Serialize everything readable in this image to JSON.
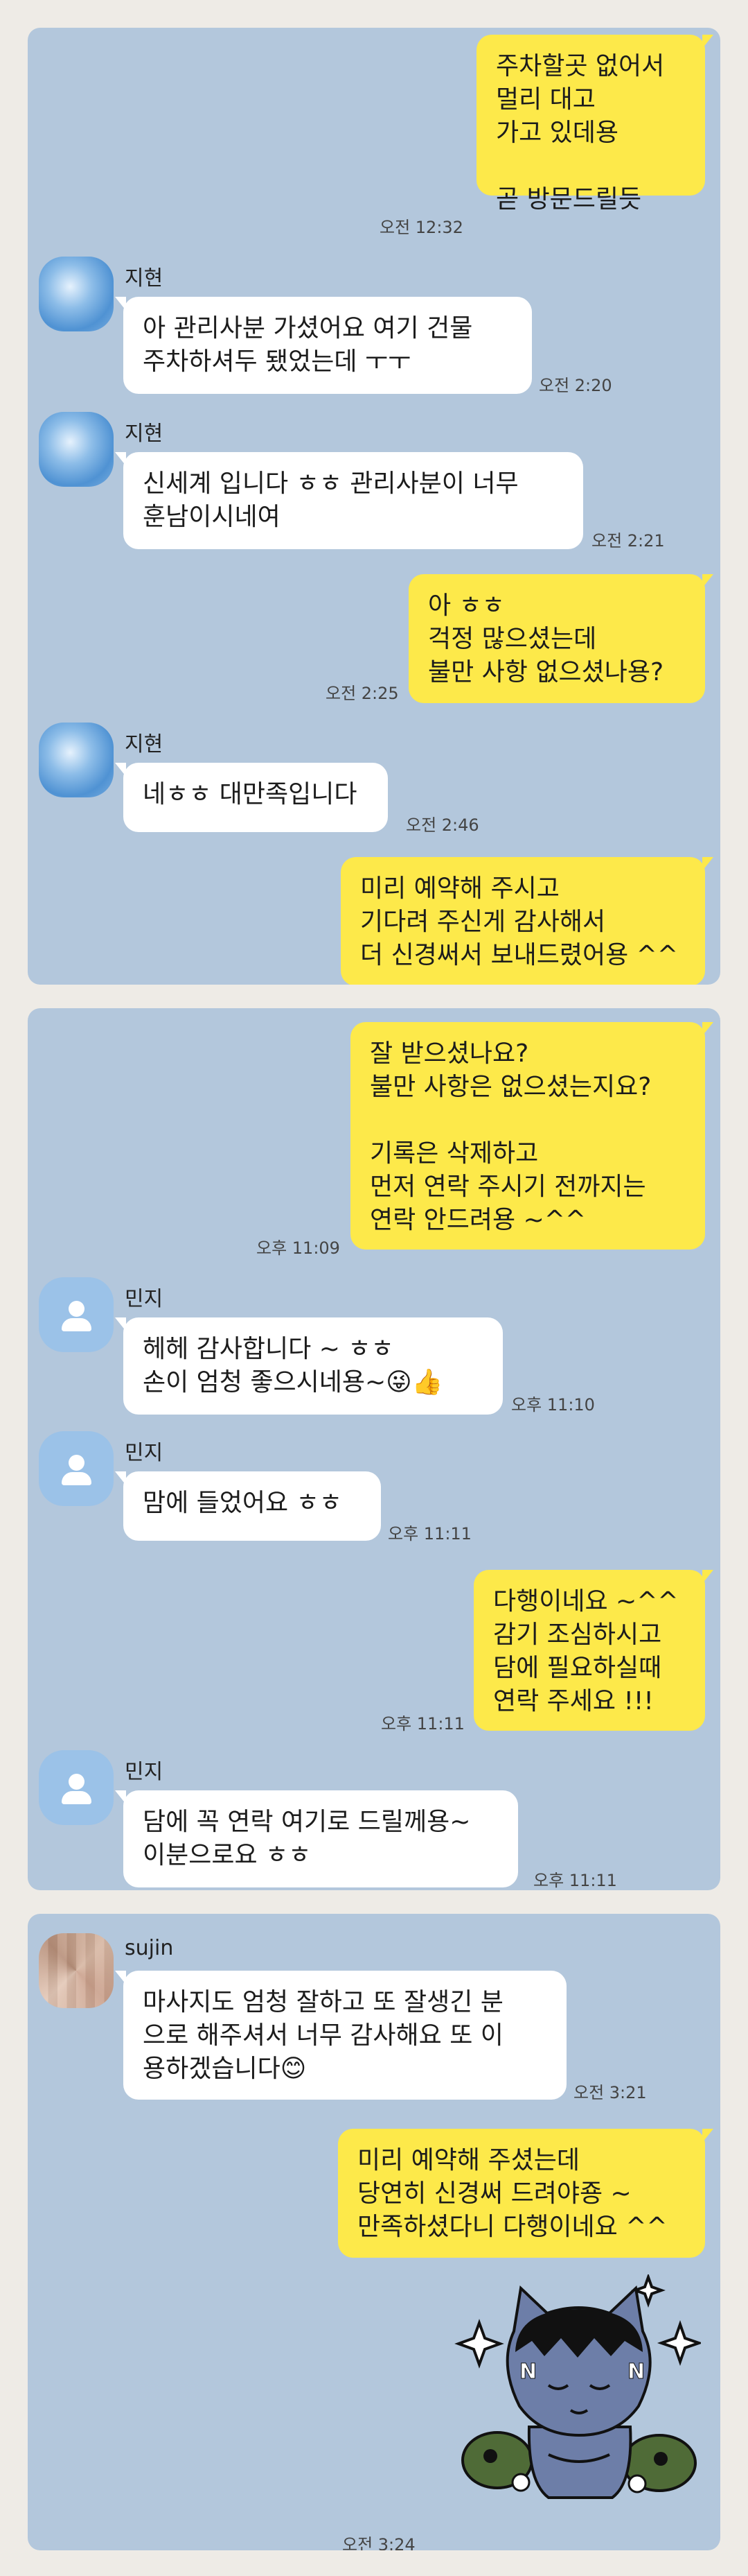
{
  "panel1": {
    "m1": {
      "text": "주차할곳 없어서\n멀리 대고\n가고 있데용\n\n곧 방문드릴듯",
      "time": "오전 12:32"
    },
    "m2": {
      "sender": "지현",
      "text": "아 관리사분 가셨어요 여기 건물\n주차하셔두 됐었는데 ㅜㅜ",
      "time": "오전 2:20"
    },
    "m3": {
      "sender": "지현",
      "text": "신세계 입니다 ㅎㅎ 관리사분이 너무\n훈남이시네여",
      "time": "오전 2:21"
    },
    "m4": {
      "text": "아 ㅎㅎ\n걱정 많으셨는데\n불만 사항 없으셨나용?",
      "time": "오전 2:25"
    },
    "m5": {
      "sender": "지현",
      "text": "네ㅎㅎ 대만족입니다",
      "time": "오전 2:46"
    },
    "m6": {
      "text": "미리 예약해 주시고\n기다려 주신게 감사해서\n더 신경써서 보내드렸어용 ^^"
    }
  },
  "panel2": {
    "m1": {
      "text": "잘 받으셨나요?\n불만 사항은 없으셨는지요?\n\n기록은 삭제하고\n먼저 연락 주시기 전까지는\n연락 안드려용 ~^^",
      "time": "오후 11:09"
    },
    "m2": {
      "sender": "민지",
      "text": "헤헤 감사합니다 ~ ㅎㅎ\n손이 엄청 좋으시네용~",
      "emoji": "😜👍",
      "time": "오후 11:10"
    },
    "m3": {
      "sender": "민지",
      "text": "맘에 들었어요 ㅎㅎ",
      "time": "오후 11:11"
    },
    "m4": {
      "text": "다행이네요 ~^^\n감기 조심하시고\n담에 필요하실때\n연락 주세요 !!!",
      "time": "오후 11:11"
    },
    "m5": {
      "sender": "민지",
      "text": "담에 꼭 연락 여기로 드릴께용~\n이분으로요 ㅎㅎ",
      "time": "오후 11:11"
    }
  },
  "panel3": {
    "m1": {
      "sender": "sujin",
      "text": "마사지도 엄청 잘하고 또 잘생긴 분\n으로 해주셔서 너무 감사해요 또 이\n용하겠습니다",
      "emoji": "😊",
      "time": "오전 3:21"
    },
    "m2": {
      "text": "미리 예약해 주셨는데\n당연히 신경써 드려야죵 ~\n만족하셨다니 다행이네요 ^^"
    },
    "m3": {
      "time": "오전 3:24"
    }
  },
  "colors": {
    "my_bubble": "#fde94a",
    "their_bubble": "#ffffff",
    "chat_bg": "#b3c7dc"
  }
}
